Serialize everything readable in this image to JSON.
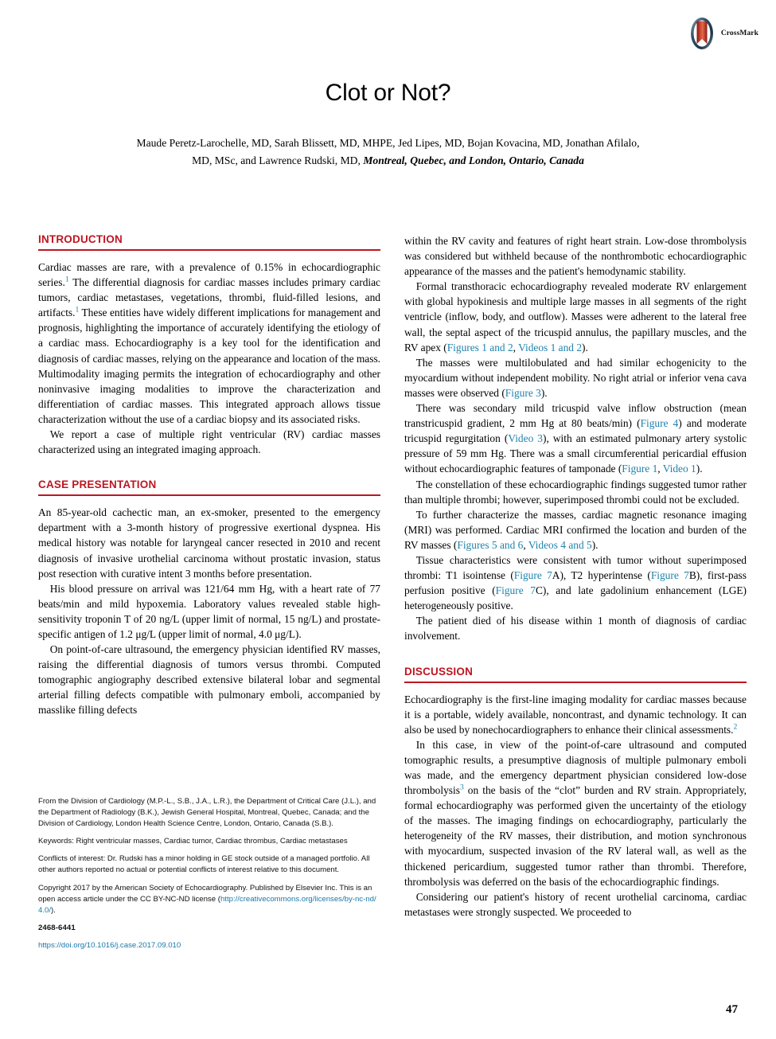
{
  "article": {
    "title": "Clot or Not?",
    "authors": "Maude Peretz-Larochelle, MD, Sarah Blissett, MD, MHPE, Jed Lipes, MD, Bojan Kovacina, MD, Jonathan Afilalo, MD, MSc, and Lawrence Rudski, MD, ",
    "affiliation_italic": "Montreal, Quebec, and London, Ontario, Canada",
    "page_number": "47"
  },
  "crossmark": {
    "label": "CrossMark",
    "ring_color": "#3c5a72",
    "ribbon_color": "#b4231f"
  },
  "colors": {
    "heading_red": "#be1622",
    "link_blue": "#1f82ad"
  },
  "sections": {
    "introduction": {
      "heading": "INTRODUCTION",
      "paragraphs": [
        "Cardiac masses are rare, with a prevalence of 0.15% in echocardiographic series.1 The differential diagnosis for cardiac masses includes primary cardiac tumors, cardiac metastases, vegetations, thrombi, fluid-filled lesions, and artifacts.1 These entities have widely different implications for management and prognosis, highlighting the importance of accurately identifying the etiology of a cardiac mass. Echocardiography is a key tool for the identification and diagnosis of cardiac masses, relying on the appearance and location of the mass. Multimodality imaging permits the integration of echocardiography and other noninvasive imaging modalities to improve the characterization and differentiation of cardiac masses. This integrated approach allows tissue characterization without the use of a cardiac biopsy and its associated risks.",
        "We report a case of multiple right ventricular (RV) cardiac masses characterized using an integrated imaging approach."
      ]
    },
    "case_presentation": {
      "heading": "CASE PRESENTATION",
      "paragraphs": [
        "An 85-year-old cachectic man, an ex-smoker, presented to the emergency department with a 3-month history of progressive exertional dyspnea. His medical history was notable for laryngeal cancer resected in 2010 and recent diagnosis of invasive urothelial carcinoma without prostatic invasion, status post resection with curative intent 3 months before presentation.",
        "His blood pressure on arrival was 121/64 mm Hg, with a heart rate of 77 beats/min and mild hypoxemia. Laboratory values revealed stable high-sensitivity troponin T of 20 ng/L (upper limit of normal, 15 ng/L) and prostate-specific antigen of 1.2 μg/L (upper limit of normal, 4.0 μg/L).",
        "On point-of-care ultrasound, the emergency physician identified RV masses, raising the differential diagnosis of tumors versus thrombi. Computed tomographic angiography described extensive bilateral lobar and segmental arterial filling defects compatible with pulmonary emboli, accompanied by masslike filling defects"
      ]
    },
    "right_column_continued": {
      "paragraphs": [
        "within the RV cavity and features of right heart strain. Low-dose thrombolysis was considered but withheld because of the nonthrombotic echocardiographic appearance of the masses and the patient's hemodynamic stability.",
        "Formal transthoracic echocardiography revealed moderate RV enlargement with global hypokinesis and multiple large masses in all segments of the right ventricle (inflow, body, and outflow). Masses were adherent to the lateral free wall, the septal aspect of the tricuspid annulus, the papillary muscles, and the RV apex (Figures 1 and 2, Videos 1 and 2).",
        "The masses were multilobulated and had similar echogenicity to the myocardium without independent mobility. No right atrial or inferior vena cava masses were observed (Figure 3).",
        "There was secondary mild tricuspid valve inflow obstruction (mean transtricuspid gradient, 2 mm Hg at 80 beats/min) (Figure 4) and moderate tricuspid regurgitation (Video 3), with an estimated pulmonary artery systolic pressure of 59 mm Hg. There was a small circumferential pericardial effusion without echocardiographic features of tamponade (Figure 1, Video 1).",
        "The constellation of these echocardiographic findings suggested tumor rather than multiple thrombi; however, superimposed thrombi could not be excluded.",
        "To further characterize the masses, cardiac magnetic resonance imaging (MRI) was performed. Cardiac MRI confirmed the location and burden of the RV masses (Figures 5 and 6, Videos 4 and 5).",
        "Tissue characteristics were consistent with tumor without superimposed thrombi: T1 isointense (Figure 7A), T2 hyperintense (Figure 7B), first-pass perfusion positive (Figure 7C), and late gadolinium enhancement (LGE) heterogeneously positive.",
        "The patient died of his disease within 1 month of diagnosis of cardiac involvement."
      ]
    },
    "discussion": {
      "heading": "DISCUSSION",
      "paragraphs": [
        "Echocardiography is the first-line imaging modality for cardiac masses because it is a portable, widely available, noncontrast, and dynamic technology. It can also be used by nonechocardiographers to enhance their clinical assessments.2",
        "In this case, in view of the point-of-care ultrasound and computed tomographic results, a presumptive diagnosis of multiple pulmonary emboli was made, and the emergency department physician considered low-dose thrombolysis3 on the basis of the “clot” burden and RV strain. Appropriately, formal echocardiography was performed given the uncertainty of the etiology of the masses. The imaging findings on echocardiography, particularly the heterogeneity of the RV masses, their distribution, and motion synchronous with myocardium, suspected invasion of the RV lateral wall, as well as the thickened pericardium, suggested tumor rather than thrombi. Therefore, thrombolysis was deferred on the basis of the echocardiographic findings.",
        "Considering our patient's history of recent urothelial carcinoma, cardiac metastases were strongly suspected. We proceeded to"
      ]
    }
  },
  "footnotes": {
    "affiliations": "From the Division of Cardiology (M.P.-L., S.B., J.A., L.R.), the Department of Critical Care (J.L.), and the Department of Radiology (B.K.), Jewish General Hospital, Montreal, Quebec, Canada; and the Division of Cardiology, London Health Science Centre, London, Ontario, Canada (S.B.).",
    "keywords": "Keywords: Right ventricular masses, Cardiac tumor, Cardiac thrombus, Cardiac metastases",
    "conflicts": "Conflicts of interest: Dr. Rudski has a minor holding in GE stock outside of a managed portfolio. All other authors reported no actual or potential conflicts of interest relative to this document.",
    "copyright_prefix": "Copyright 2017 by the American Society of Echocardiography. Published by Elsevier Inc. This is an open access article under the CC BY-NC-ND license (",
    "copyright_link": "http://creativecommons.org/licenses/by-nc-nd/4.0/",
    "copyright_suffix": ").",
    "issn": "2468-6441",
    "doi": "https://doi.org/10.1016/j.case.2017.09.010"
  }
}
